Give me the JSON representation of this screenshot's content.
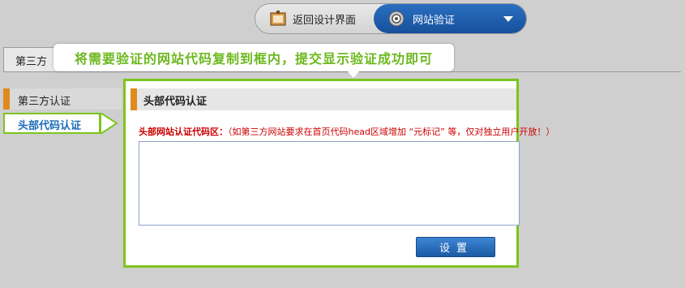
{
  "toolbar": {
    "back_label": "返回设计界面",
    "back_icon": "design-board-icon",
    "verify_label": "网站验证",
    "verify_icon": "gear-icon",
    "accent": "#1c5fae"
  },
  "background_tab": {
    "label": "第三方"
  },
  "sidebar": {
    "heading": "第三方认证",
    "active_item": "头部代码认证"
  },
  "tooltip": {
    "text": "将需要验证的网站代码复制到框内，提交显示验证成功即可"
  },
  "dialog": {
    "title": "头部代码认证",
    "field_label": "头部网站认证代码区：",
    "field_hint": "（如第三方网站要求在首页代码head区域增加 “元标记” 等，仅对独立用户开放！）",
    "textarea_value": "",
    "submit_label": "设置"
  },
  "colors": {
    "highlight_green": "#7cc51f",
    "marker_orange": "#e08a1e",
    "warning_red": "#cc0000",
    "button_blue": "#2a72c4"
  }
}
